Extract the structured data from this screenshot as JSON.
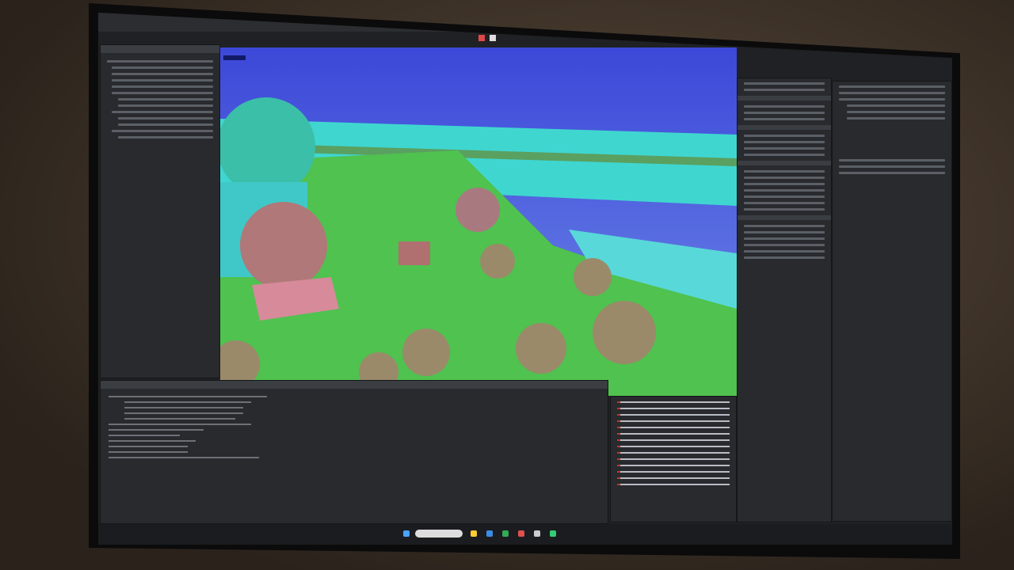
{
  "colors": {
    "sky": "#4a5be0",
    "sea": "#3fd6d0",
    "ground": "#4fc24f",
    "panel": "#282a2e",
    "error": "#c0392b",
    "dome_teal": "#3bbfa8",
    "dome_pink": "#b07878"
  },
  "icons": [
    "unity-editor-toolbar",
    "play-icon",
    "pause-icon",
    "step-icon",
    "windows-start-icon",
    "taskbar-app-icons"
  ]
}
